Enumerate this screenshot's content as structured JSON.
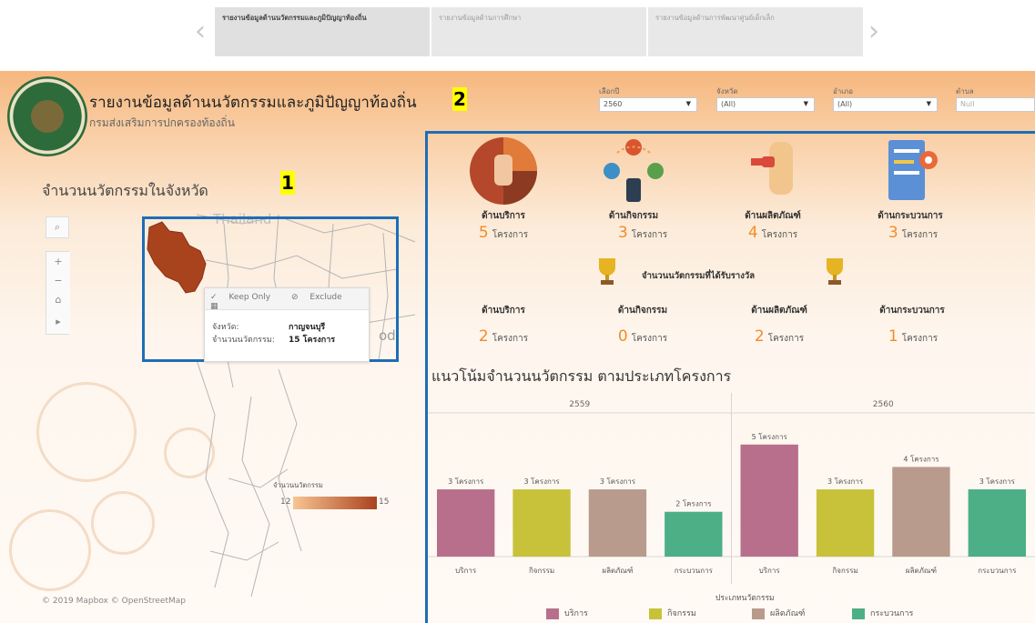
{
  "tabs": {
    "items": [
      {
        "label": "รายงานข้อมูลด้านนวัตกรรมและภูมิปัญญาท้องถิ่น"
      },
      {
        "label": "รายงานข้อมูลด้านการศึกษา"
      },
      {
        "label": "รายงานข้อมูลด้านการพัฒนาศูนย์เด็กเล็ก"
      }
    ],
    "prev_icon": "chevron-left-icon",
    "next_icon": "chevron-right-icon"
  },
  "header": {
    "title": "รายงานข้อมูลด้านนวัตกรรมและภูมิปัญญาท้องถิ่น",
    "subtitle": "กรมส่งเสริมการปกครองท้องถิ่น"
  },
  "markers": {
    "one": "1",
    "two": "2"
  },
  "filters": [
    {
      "label": "เลือกปี",
      "value": "2560"
    },
    {
      "label": "จังหวัด",
      "value": "(All)"
    },
    {
      "label": "อำเภอ",
      "value": "(All)"
    },
    {
      "label": "ตำบล",
      "value": "Null"
    }
  ],
  "map": {
    "title": "จำนวนนวัตกรรมในจังหวัด",
    "country_label": "Thailand",
    "edge_label": "od",
    "tooltip": {
      "keep_only": "Keep Only",
      "exclude": "Exclude",
      "province_label": "จังหวัด:",
      "province_value": "กาญจนบุรี",
      "count_label": "จำนวนนวัตกรรม:",
      "count_value": "15 โครงการ"
    },
    "legend": {
      "title": "จำนวนนวัตกรรม",
      "min": "12",
      "max": "15"
    },
    "copyright": "© 2019 Mapbox © OpenStreetMap",
    "region_color": "#a9431e"
  },
  "categories": [
    {
      "name": "ด้านบริการ",
      "count": "5",
      "unit": "โครงการ"
    },
    {
      "name": "ด้านกิจกรรม",
      "count": "3",
      "unit": "โครงการ"
    },
    {
      "name": "ด้านผลิตภัณฑ์",
      "count": "4",
      "unit": "โครงการ"
    },
    {
      "name": "ด้านกระบวนการ",
      "count": "3",
      "unit": "โครงการ"
    }
  ],
  "awards": {
    "title": "จำนวนนวัตกรรมที่ได้รับรางวัล",
    "items": [
      {
        "name": "ด้านบริการ",
        "count": "2",
        "unit": "โครงการ"
      },
      {
        "name": "ด้านกิจกรรม",
        "count": "0",
        "unit": "โครงการ"
      },
      {
        "name": "ด้านผลิตภัณฑ์",
        "count": "2",
        "unit": "โครงการ"
      },
      {
        "name": "ด้านกระบวนการ",
        "count": "1",
        "unit": "โครงการ"
      }
    ]
  },
  "colors": {
    "accent": "#f28c28",
    "frame": "#1f6db5",
    "service": "#b86f8c",
    "activity": "#c7c23a",
    "product": "#b89b8c",
    "process": "#4caf86"
  },
  "chart_data": {
    "type": "bar",
    "title": "แนวโน้มจำนวนนวัตกรรม ตามประเภทโครงการ",
    "panels": [
      "2559",
      "2560"
    ],
    "categories": [
      "บริการ",
      "กิจกรรม",
      "ผลิตภัณฑ์",
      "กระบวนการ"
    ],
    "series": [
      {
        "panel": "2559",
        "values": [
          3,
          3,
          3,
          2
        ]
      },
      {
        "panel": "2560",
        "values": [
          5,
          3,
          4,
          3
        ]
      }
    ],
    "value_unit": "โครงการ",
    "ylim": [
      0,
      5.6
    ],
    "legend": {
      "title": "ประเภทนวัตกรรม",
      "items": [
        "บริการ",
        "กิจกรรม",
        "ผลิตภัณฑ์",
        "กระบวนการ"
      ],
      "colors": [
        "#b86f8c",
        "#c7c23a",
        "#b89b8c",
        "#4caf86"
      ],
      "placement": "bottom"
    },
    "grid": false
  }
}
